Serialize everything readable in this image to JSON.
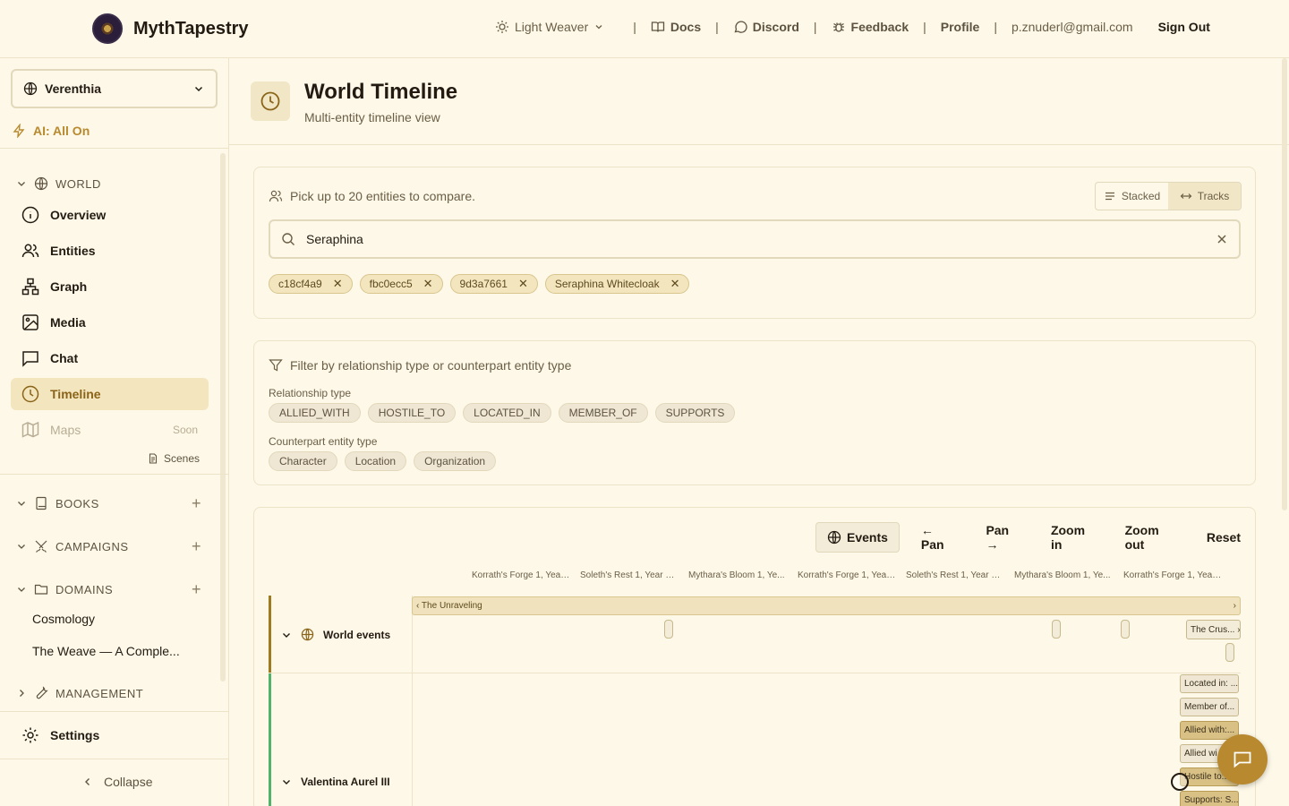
{
  "brand": {
    "name": "MythTapestry"
  },
  "topnav": {
    "theme_label": "Light Weaver",
    "docs": "Docs",
    "discord": "Discord",
    "feedback": "Feedback",
    "profile": "Profile",
    "email": "p.znuderl@gmail.com",
    "signout": "Sign Out",
    "separator": "|"
  },
  "sidebar": {
    "world": "Verenthia",
    "ai_status": "AI: All On",
    "world_section": "WORLD",
    "items": [
      {
        "label": "Overview",
        "icon": "info-icon"
      },
      {
        "label": "Entities",
        "icon": "users-icon"
      },
      {
        "label": "Graph",
        "icon": "graph-icon"
      },
      {
        "label": "Media",
        "icon": "image-icon"
      },
      {
        "label": "Chat",
        "icon": "message-icon"
      },
      {
        "label": "Timeline",
        "icon": "clock-icon",
        "active": true
      },
      {
        "label": "Maps",
        "icon": "map-icon",
        "badge": "Soon"
      }
    ],
    "scenes": "Scenes",
    "books": "BOOKS",
    "campaigns": "CAMPAIGNS",
    "domains": "DOMAINS",
    "domain_items": [
      "Cosmology",
      "The Weave — A Comple..."
    ],
    "management": "MANAGEMENT",
    "settings": "Settings",
    "collapse": "Collapse"
  },
  "page": {
    "title": "World Timeline",
    "subtitle": "Multi-entity timeline view"
  },
  "picker": {
    "label": "Pick up to 20 entities to compare.",
    "view_stacked": "Stacked",
    "view_tracks": "Tracks",
    "active_view": "Tracks",
    "search_value": "Seraphina",
    "selected": [
      "c18cf4a9",
      "fbc0ecc5",
      "9d3a7661",
      "Seraphina Whitecloak"
    ]
  },
  "filters": {
    "label": "Filter by relationship type or counterpart entity type",
    "relationship_label": "Relationship type",
    "relationship_types": [
      "ALLIED_WITH",
      "HOSTILE_TO",
      "LOCATED_IN",
      "MEMBER_OF",
      "SUPPORTS"
    ],
    "counterpart_label": "Counterpart entity type",
    "counterpart_types": [
      "Character",
      "Location",
      "Organization"
    ]
  },
  "timeline": {
    "events_btn": "Events",
    "pan_left": "← Pan",
    "pan_right": "Pan →",
    "zoom_in": "Zoom in",
    "zoom_out": "Zoom out",
    "reset": "Reset",
    "ticks": [
      "Korrath's Forge 1, Year ...",
      "Soleth's Rest 1, Year 53...",
      "Mythara's Bloom 1, Ye...",
      "Korrath's Forge 1, Year ...",
      "Soleth's Rest 1, Year 56...",
      "Mythara's Bloom 1, Ye...",
      "Korrath's Forge 1, Year ..."
    ],
    "tracks": [
      {
        "name": "World events",
        "color": "#a07a1e"
      },
      {
        "name": "Valentina Aurel III",
        "color": "#4fb36b"
      }
    ],
    "era_label": "‹ The Unraveling",
    "era_end": "›",
    "event_label": "The Crus... ›",
    "relations": [
      "Located in: ...",
      "Member of...",
      "Allied with:...",
      "Allied wi...",
      "Hostile to:...",
      "Supports: S..."
    ]
  },
  "colors": {
    "accent": "#b8892e",
    "background": "#fdf8e8",
    "active_bg": "#f3e5be"
  }
}
